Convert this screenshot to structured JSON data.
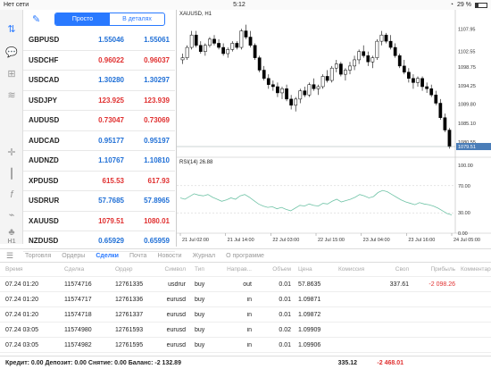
{
  "statusbar": {
    "network": "Нет сети",
    "time": "5:12",
    "battery": "29 %",
    "battery_level": 0.29
  },
  "header": {
    "tab_simple": "Просто",
    "tab_detail": "В деталях"
  },
  "quotes": [
    {
      "symbol": "GBPUSD",
      "bid": "1.55046",
      "ask": "1.55061",
      "dir": "up"
    },
    {
      "symbol": "USDCHF",
      "bid": "0.96022",
      "ask": "0.96037",
      "dir": "down"
    },
    {
      "symbol": "USDCAD",
      "bid": "1.30280",
      "ask": "1.30297",
      "dir": "up"
    },
    {
      "symbol": "USDJPY",
      "bid": "123.925",
      "ask": "123.939",
      "dir": "down"
    },
    {
      "symbol": "AUDUSD",
      "bid": "0.73047",
      "ask": "0.73069",
      "dir": "down"
    },
    {
      "symbol": "AUDCAD",
      "bid": "0.95177",
      "ask": "0.95197",
      "dir": "up"
    },
    {
      "symbol": "AUDNZD",
      "bid": "1.10767",
      "ask": "1.10810",
      "dir": "up"
    },
    {
      "symbol": "XPDUSD",
      "bid": "615.53",
      "ask": "617.93",
      "dir": "down"
    },
    {
      "symbol": "USDRUR",
      "bid": "57.7685",
      "ask": "57.8965",
      "dir": "up"
    },
    {
      "symbol": "XAUUSD",
      "bid": "1079.51",
      "ask": "1080.01",
      "dir": "down"
    },
    {
      "symbol": "NZDUSD",
      "bid": "0.65929",
      "ask": "0.65959",
      "dir": "up"
    }
  ],
  "chart_data": {
    "type": "candlestick",
    "title": "XAUUSD, H1",
    "price_ticks": [
      "1107.95",
      "1102.55",
      "1098.75",
      "1094.25",
      "1089.80",
      "1085.10",
      "1080.55"
    ],
    "current_price": "1079.51",
    "x_ticks": [
      "21 Jul 02:00",
      "21 Jul 14:00",
      "22 Jul 03:00",
      "22 Jul 15:00",
      "23 Jul 04:00",
      "23 Jul 16:00",
      "24 Jul 05:00"
    ],
    "candles": [
      [
        1100.5,
        1102.0,
        1099.5,
        1101.0
      ],
      [
        1101.0,
        1104.0,
        1100.5,
        1103.5
      ],
      [
        1103.5,
        1107.5,
        1103.0,
        1106.5
      ],
      [
        1106.5,
        1107.5,
        1103.5,
        1104.0
      ],
      [
        1104.0,
        1105.0,
        1102.0,
        1102.5
      ],
      [
        1102.5,
        1104.5,
        1101.5,
        1104.0
      ],
      [
        1104.0,
        1106.0,
        1103.5,
        1105.5
      ],
      [
        1105.5,
        1106.5,
        1104.0,
        1104.5
      ],
      [
        1104.5,
        1105.5,
        1103.0,
        1103.5
      ],
      [
        1103.5,
        1104.5,
        1101.5,
        1102.0
      ],
      [
        1102.0,
        1103.5,
        1101.0,
        1103.0
      ],
      [
        1103.0,
        1105.0,
        1102.5,
        1104.5
      ],
      [
        1104.5,
        1105.0,
        1103.0,
        1103.5
      ],
      [
        1103.5,
        1108.0,
        1103.0,
        1107.5
      ],
      [
        1107.5,
        1109.0,
        1105.5,
        1106.0
      ],
      [
        1106.0,
        1107.5,
        1103.5,
        1104.0
      ],
      [
        1104.0,
        1104.5,
        1100.5,
        1101.0
      ],
      [
        1101.0,
        1101.5,
        1097.5,
        1098.0
      ],
      [
        1098.0,
        1099.0,
        1095.5,
        1096.0
      ],
      [
        1096.0,
        1097.0,
        1093.5,
        1094.5
      ],
      [
        1094.5,
        1095.5,
        1093.0,
        1094.0
      ],
      [
        1094.0,
        1095.0,
        1091.5,
        1092.5
      ],
      [
        1092.5,
        1094.0,
        1091.0,
        1093.5
      ],
      [
        1093.5,
        1094.5,
        1090.5,
        1091.0
      ],
      [
        1091.0,
        1092.0,
        1088.5,
        1089.5
      ],
      [
        1089.5,
        1091.5,
        1088.0,
        1091.0
      ],
      [
        1091.0,
        1093.5,
        1090.0,
        1093.0
      ],
      [
        1093.0,
        1094.0,
        1091.5,
        1092.0
      ],
      [
        1092.0,
        1095.0,
        1091.5,
        1094.5
      ],
      [
        1094.5,
        1096.0,
        1093.0,
        1093.5
      ],
      [
        1093.5,
        1094.5,
        1092.0,
        1094.0
      ],
      [
        1094.0,
        1097.0,
        1093.5,
        1096.5
      ],
      [
        1096.5,
        1098.0,
        1095.0,
        1095.5
      ],
      [
        1095.5,
        1099.0,
        1095.0,
        1098.5
      ],
      [
        1098.5,
        1100.5,
        1097.5,
        1099.5
      ],
      [
        1099.5,
        1100.0,
        1096.5,
        1097.0
      ],
      [
        1097.0,
        1098.5,
        1095.5,
        1098.0
      ],
      [
        1098.0,
        1100.0,
        1097.0,
        1099.0
      ],
      [
        1099.0,
        1101.5,
        1098.0,
        1100.5
      ],
      [
        1100.5,
        1103.0,
        1099.5,
        1102.5
      ],
      [
        1102.5,
        1104.0,
        1101.0,
        1101.5
      ],
      [
        1101.5,
        1102.5,
        1099.0,
        1100.0
      ],
      [
        1100.0,
        1101.5,
        1098.5,
        1101.0
      ],
      [
        1101.0,
        1105.5,
        1100.5,
        1105.0
      ],
      [
        1105.0,
        1107.5,
        1104.0,
        1106.5
      ],
      [
        1106.5,
        1107.0,
        1104.5,
        1105.0
      ],
      [
        1105.0,
        1106.5,
        1103.0,
        1103.5
      ],
      [
        1103.5,
        1104.5,
        1101.0,
        1101.5
      ],
      [
        1101.5,
        1102.0,
        1098.5,
        1099.0
      ],
      [
        1099.0,
        1100.5,
        1097.0,
        1097.5
      ],
      [
        1097.5,
        1098.5,
        1095.0,
        1096.0
      ],
      [
        1096.0,
        1097.0,
        1093.5,
        1095.0
      ],
      [
        1095.0,
        1096.5,
        1094.0,
        1096.0
      ],
      [
        1096.0,
        1096.5,
        1093.0,
        1094.0
      ],
      [
        1094.0,
        1095.0,
        1092.5,
        1093.5
      ],
      [
        1093.5,
        1094.5,
        1091.5,
        1092.0
      ],
      [
        1092.0,
        1093.0,
        1089.5,
        1090.0
      ],
      [
        1090.0,
        1091.0,
        1086.0,
        1086.5
      ],
      [
        1086.5,
        1087.5,
        1083.0,
        1083.5
      ],
      [
        1083.5,
        1084.0,
        1079.0,
        1079.5
      ]
    ],
    "rsi_label": "RSI(14) 26.88",
    "rsi_ticks": [
      "100.00",
      "70.00",
      "30.00",
      "0.00"
    ],
    "rsi_values": [
      52,
      50,
      54,
      58,
      56,
      55,
      57,
      53,
      50,
      47,
      49,
      52,
      50,
      55,
      57,
      53,
      48,
      43,
      40,
      38,
      39,
      36,
      38,
      35,
      33,
      37,
      41,
      40,
      43,
      41,
      40,
      44,
      43,
      47,
      50,
      46,
      48,
      50,
      53,
      57,
      55,
      52,
      54,
      60,
      63,
      61,
      57,
      53,
      49,
      46,
      44,
      42,
      45,
      43,
      42,
      40,
      37,
      33,
      29,
      27
    ]
  },
  "tabs": {
    "trading": "Торговля",
    "orders": "Ордеры",
    "deals": "Сделки",
    "mail": "Почта",
    "news": "Новости",
    "journal": "Журнал",
    "about": "О программе"
  },
  "table": {
    "headers": {
      "time": "Время",
      "deal": "Сделка",
      "order": "Ордер",
      "symbol": "Символ",
      "type": "Тип",
      "direction": "Направ...",
      "volume": "Объем",
      "price": "Цена",
      "commission": "Комиссия",
      "swap": "Своп",
      "profit": "Прибыль",
      "comment": "Комментарий"
    },
    "rows": [
      {
        "time": "07.24 01:20",
        "deal": "11574716",
        "order": "12761335",
        "symbol": "usdrur",
        "type": "buy",
        "direction": "out",
        "volume": "0.01",
        "price": "57.8635",
        "commission": "",
        "swap": "337.61",
        "profit": "-2 098.26"
      },
      {
        "time": "07.24 01:20",
        "deal": "11574717",
        "order": "12761336",
        "symbol": "eurusd",
        "type": "buy",
        "direction": "in",
        "volume": "0.01",
        "price": "1.09871",
        "commission": "",
        "swap": "",
        "profit": ""
      },
      {
        "time": "07.24 01:20",
        "deal": "11574718",
        "order": "12761337",
        "symbol": "eurusd",
        "type": "buy",
        "direction": "in",
        "volume": "0.01",
        "price": "1.09872",
        "commission": "",
        "swap": "",
        "profit": ""
      },
      {
        "time": "07.24 03:05",
        "deal": "11574980",
        "order": "12761593",
        "symbol": "eurusd",
        "type": "buy",
        "direction": "in",
        "volume": "0.02",
        "price": "1.09909",
        "commission": "",
        "swap": "",
        "profit": ""
      },
      {
        "time": "07.24 03:05",
        "deal": "11574982",
        "order": "12761595",
        "symbol": "eurusd",
        "type": "buy",
        "direction": "in",
        "volume": "0.01",
        "price": "1.09906",
        "commission": "",
        "swap": "",
        "profit": ""
      }
    ]
  },
  "footer": {
    "summary": "Кредит: 0.00 Депозит: 0.00 Снятие: 0.00 Баланс: -2 132.89",
    "swap_total": "335.12",
    "profit_total": "-2 468.01"
  }
}
